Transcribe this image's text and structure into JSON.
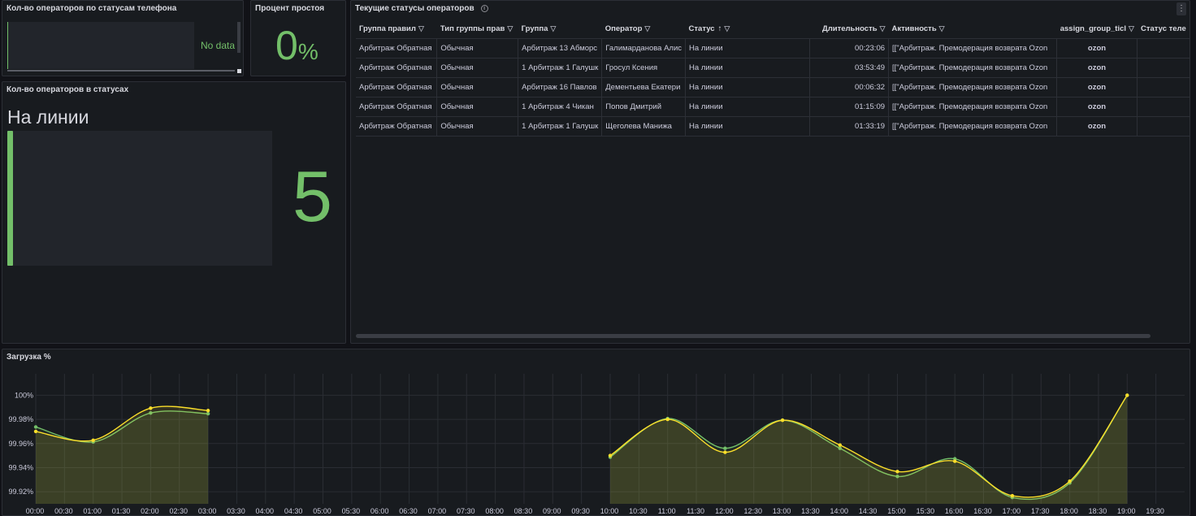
{
  "panels": {
    "phone_status": {
      "title": "Кол-во операторов по статусам телефона",
      "no_data": "No data"
    },
    "idle_percent": {
      "title": "Процент простоя",
      "value": "0",
      "unit": "%"
    },
    "operators_in_status": {
      "title": "Кол-во операторов в статусах",
      "label": "На линии",
      "value": "5",
      "fill_fraction": 1.0
    },
    "current_statuses": {
      "title": "Текущие статусы операторов",
      "info_icon": "info-icon",
      "menu_icon": "kebab-menu-icon",
      "columns": [
        "Группа правил",
        "Тип группы прав",
        "Группа",
        "Оператор",
        "Статус",
        "Длительность",
        "Активность",
        "assign_group_ticl",
        "Статус теле"
      ],
      "sorted_column": "Статус",
      "sort_direction": "asc",
      "rows": [
        [
          "Арбитраж Обратная",
          "Обычная",
          "Арбитраж 13 Абморс",
          "Галимарданова Алис",
          "На линии",
          "00:23:06",
          "[[\"Арбитраж. Премодерация возврата Ozon",
          "ozon",
          ""
        ],
        [
          "Арбитраж Обратная",
          "Обычная",
          "1 Арбитраж 1 Галушк",
          "Гросул Ксения",
          "На линии",
          "03:53:49",
          "[[\"Арбитраж. Премодерация возврата Ozon",
          "ozon",
          ""
        ],
        [
          "Арбитраж Обратная",
          "Обычная",
          "Арбитраж 16 Павлов",
          "Дементьева Екатери",
          "На линии",
          "00:06:32",
          "[[\"Арбитраж. Премодерация возврата Ozon",
          "ozon",
          ""
        ],
        [
          "Арбитраж Обратная",
          "Обычная",
          "1 Арбитраж 4 Чикан",
          "Попов Дмитрий",
          "На линии",
          "01:15:09",
          "[[\"Арбитраж. Премодерация возврата Ozon",
          "ozon",
          ""
        ],
        [
          "Арбитраж Обратная",
          "Обычная",
          "1 Арбитраж 1 Галушк",
          "Щеголева Манижа",
          "На линии",
          "01:33:19",
          "[[\"Арбитраж. Премодерация возврата Ozon",
          "ozon",
          ""
        ]
      ]
    },
    "load": {
      "title": "Загрузка %"
    }
  },
  "colors": {
    "green": "#73bf69",
    "yellow": "#fade2a",
    "orange": "#ff9830",
    "panel_bg": "#181b1f"
  },
  "chart_data": {
    "type": "line",
    "title": "Загрузка %",
    "x_ticks": [
      "00:00",
      "00:30",
      "01:00",
      "01:30",
      "02:00",
      "02:30",
      "03:00",
      "03:30",
      "04:00",
      "04:30",
      "05:00",
      "05:30",
      "06:00",
      "06:30",
      "07:00",
      "07:30",
      "08:00",
      "08:30",
      "09:00",
      "09:30",
      "10:00",
      "10:30",
      "11:00",
      "11:30",
      "12:00",
      "12:30",
      "13:00",
      "13:30",
      "14:00",
      "14:30",
      "15:00",
      "15:30",
      "16:00",
      "16:30",
      "17:00",
      "17:30",
      "18:00",
      "18:30",
      "19:00",
      "19:30"
    ],
    "y_ticks": [
      "99.92%",
      "99.94%",
      "99.96%",
      "99.98%",
      "100%"
    ],
    "ylim": [
      99.91,
      100.007
    ],
    "x_unit_hours": true,
    "series": [
      {
        "color": "#73bf69",
        "segments": [
          {
            "x": [
              0,
              1,
              2,
              3
            ],
            "y": [
              99.9737,
              99.9613,
              99.9853,
              99.9847
            ]
          },
          {
            "x": [
              10,
              11,
              12,
              13,
              14,
              15,
              16,
              17,
              18,
              19
            ],
            "y": [
              99.9487,
              99.9807,
              99.956,
              99.9793,
              99.956,
              99.9327,
              99.9473,
              99.9153,
              99.9273,
              100.0
            ]
          }
        ]
      },
      {
        "color": "#fade2a",
        "segments": [
          {
            "x": [
              0,
              1,
              2,
              3
            ],
            "y": [
              99.97,
              99.9627,
              99.9893,
              99.9873
            ]
          },
          {
            "x": [
              10,
              11,
              12,
              13,
              14,
              15,
              16,
              17,
              18,
              19
            ],
            "y": [
              99.95,
              99.98,
              99.9527,
              99.9793,
              99.9587,
              99.9367,
              99.9453,
              99.9167,
              99.9287,
              100.0
            ]
          }
        ]
      }
    ]
  }
}
